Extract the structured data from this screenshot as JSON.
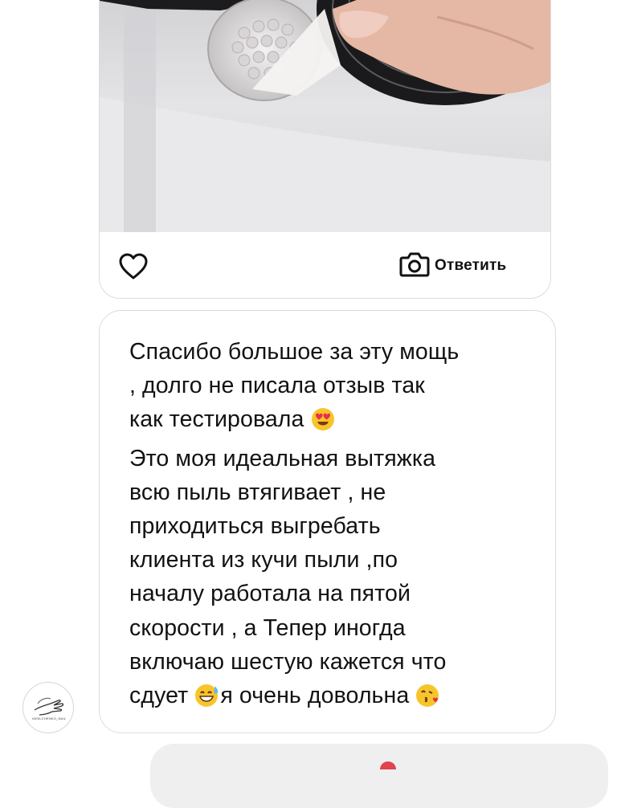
{
  "story_reply": {
    "reply_label": "Ответить",
    "icons": {
      "like": "heart-icon",
      "camera": "camera-icon"
    }
  },
  "message": {
    "lines": [
      "Спасибо большое за эту мощь",
      ", долго не писала отзыв так",
      "как тестировала",
      "Это моя идеальная вытяжка",
      "всю пыль втягивает , не",
      "приходиться выгребать",
      "клиента из кучи пыли ,по",
      "началу работала на пятой",
      "скорости , а Тепер иногда",
      "включаю шестую кажется что",
      "сдует",
      "я очень довольна"
    ],
    "emojis": {
      "heart_eyes": "heart-eyes-emoji",
      "sweat_smile": "sweat-smile-emoji",
      "kiss": "blowing-kiss-emoji"
    }
  },
  "sender": {
    "avatar_caption": "VASILCHENKO_NAIL"
  },
  "colors": {
    "bubble_border": "#dcdcdc",
    "text": "#121212",
    "incoming_bubble": "#efefef"
  }
}
